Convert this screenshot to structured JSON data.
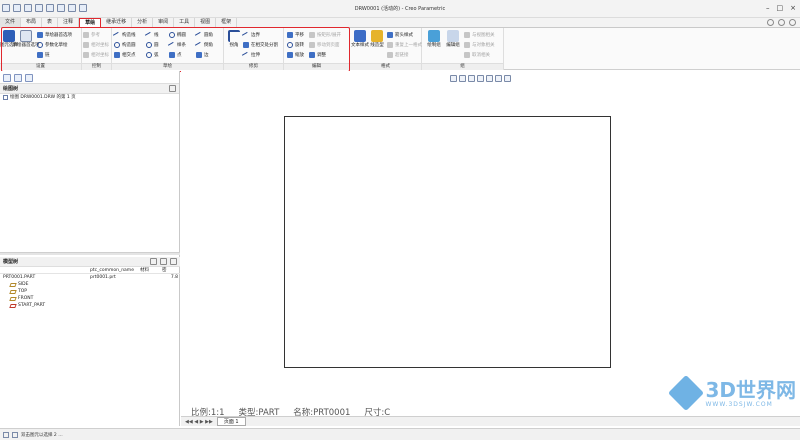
{
  "window": {
    "title": "DRW0001 (活动的) - Creo Parametric"
  },
  "tabs": [
    {
      "label": "文件",
      "active": false
    },
    {
      "label": "布局",
      "active": false
    },
    {
      "label": "表",
      "active": false
    },
    {
      "label": "注释",
      "active": false
    },
    {
      "label": "草绘",
      "active": true
    },
    {
      "label": "继承迁移",
      "active": false
    },
    {
      "label": "分析",
      "active": false
    },
    {
      "label": "审阅",
      "active": false
    },
    {
      "label": "工具",
      "active": false
    },
    {
      "label": "视图",
      "active": false
    },
    {
      "label": "框架",
      "active": false
    }
  ],
  "ribbon": {
    "settings": {
      "label": "设置",
      "big1": "图元选择",
      "big2": "草绘器首选项",
      "items": [
        "草绘器首选项",
        "参数化草绘",
        "链"
      ]
    },
    "control": {
      "label": "控制",
      "items": [
        "参考",
        "相对坐标",
        "相对坐标"
      ]
    },
    "sketch": {
      "label": "草绘",
      "col1": [
        "构造线",
        "构造圆",
        "相交点"
      ],
      "col2": [
        "线",
        "圆",
        "弧"
      ],
      "col3": [
        "椭圆",
        "样条",
        "点"
      ],
      "col4": [
        "圆角",
        "倒角",
        "边"
      ]
    },
    "trim": {
      "label": "修剪",
      "big": "拐角",
      "col": [
        "边界",
        "在相交处分割",
        "拉伸"
      ]
    },
    "edit": {
      "label": "编辑",
      "col1": [
        "平移",
        "旋转",
        "缩放"
      ],
      "col2": [
        "按矩形/展开",
        "移动到页面",
        "调整"
      ]
    },
    "format": {
      "label": "格式",
      "big1": "文本样式",
      "big2": "线造型",
      "col": [
        "箭头样式",
        "重复上一格式",
        "超链接"
      ]
    },
    "group": {
      "label": "组",
      "big1": "绘制组",
      "big2": "编辑组",
      "col": [
        "与视图相关",
        "与对象相关",
        "取消相关"
      ]
    }
  },
  "left_panel": {
    "drawing_tree_title": "绘图树",
    "drawing_tree_item": "绘图 DRW0001.DRW 的第 1 页",
    "model_tree_title": "模型树",
    "columns": {
      "c1": "ptc_common_name",
      "c2": "材料",
      "c3": "密"
    },
    "model_root": {
      "name": "PRT0001.PART",
      "common_name": "prt0001.prt",
      "value": "7.8"
    },
    "features": [
      "SIDE",
      "TOP",
      "FRONT",
      "START_PART"
    ]
  },
  "drawing_info": {
    "scale": "比例:1:1",
    "type": "类型:PART",
    "name": "名称:PRT0001",
    "size": "尺寸:C"
  },
  "sheet_tab": "页面 1",
  "status": "双击图元以选择 2 …",
  "watermark": {
    "main": "3D世界网",
    "sub": "WWW.3DSJW.COM"
  }
}
